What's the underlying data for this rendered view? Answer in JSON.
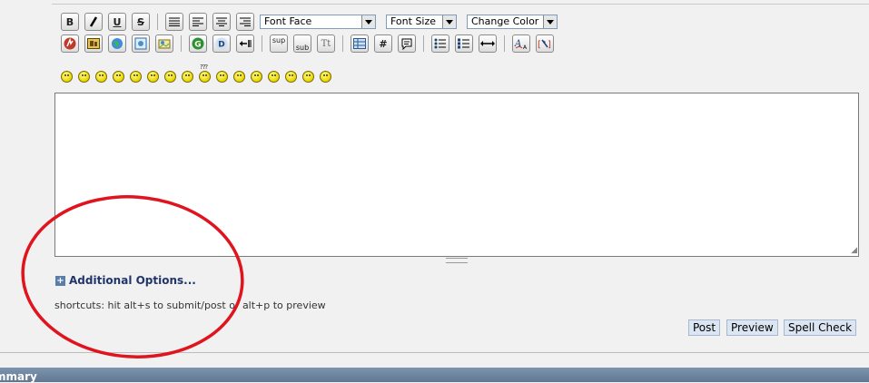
{
  "toolbar": {
    "row1": {
      "bold": "B",
      "italic": "I",
      "underline": "U",
      "strike": "S",
      "font_face": "Font Face",
      "font_size": "Font Size",
      "change_color": "Change Color"
    },
    "row2": {
      "g_label": "G",
      "d_label": "D",
      "sup": "sup",
      "sub": "sub",
      "tt": "Tt",
      "hash": "#"
    }
  },
  "smilies_label": "???",
  "additional_options": {
    "icon": "+",
    "label": "Additional Options..."
  },
  "shortcuts_text": "shortcuts: hit alt+s to submit/post or alt+p to preview",
  "buttons": {
    "post": "Post",
    "preview": "Preview",
    "spell_check": "Spell Check"
  },
  "footer_partial_text": "mmary",
  "annotation_color": "#e0141e"
}
